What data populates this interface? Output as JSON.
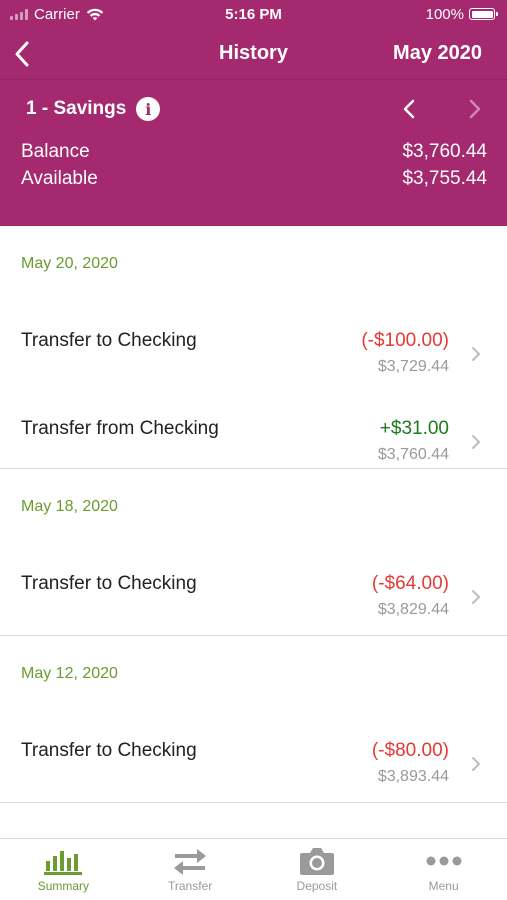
{
  "status": {
    "carrier": "Carrier",
    "time": "5:16 PM",
    "battery": "100%"
  },
  "nav": {
    "title": "History",
    "month": "May 2020"
  },
  "account": {
    "name": "1 - Savings",
    "balance_label": "Balance",
    "balance_value": "$3,760.44",
    "available_label": "Available",
    "available_value": "$3,755.44"
  },
  "groups": [
    {
      "date": "May 20, 2020",
      "transactions": [
        {
          "description": "Transfer to Checking",
          "amount": "(-$100.00)",
          "type": "debit",
          "balance": "$3,729.44"
        },
        {
          "description": "Transfer from Checking",
          "amount": "+$31.00",
          "type": "credit",
          "balance": "$3,760.44"
        }
      ]
    },
    {
      "date": "May 18, 2020",
      "transactions": [
        {
          "description": "Transfer to Checking",
          "amount": "(-$64.00)",
          "type": "debit",
          "balance": "$3,829.44"
        }
      ]
    },
    {
      "date": "May 12, 2020",
      "transactions": [
        {
          "description": "Transfer to Checking",
          "amount": "(-$80.00)",
          "type": "debit",
          "balance": "$3,893.44"
        }
      ]
    }
  ],
  "tabs": [
    {
      "label": "Summary",
      "icon": "bar-chart-icon",
      "active": true
    },
    {
      "label": "Transfer",
      "icon": "transfer-arrows-icon",
      "active": false
    },
    {
      "label": "Deposit",
      "icon": "camera-icon",
      "active": false
    },
    {
      "label": "Menu",
      "icon": "more-dots-icon",
      "active": false
    }
  ],
  "colors": {
    "brand": "#a5296f",
    "accent": "#6a9c2f",
    "debit": "#e53935",
    "credit": "#1b7c1b"
  }
}
